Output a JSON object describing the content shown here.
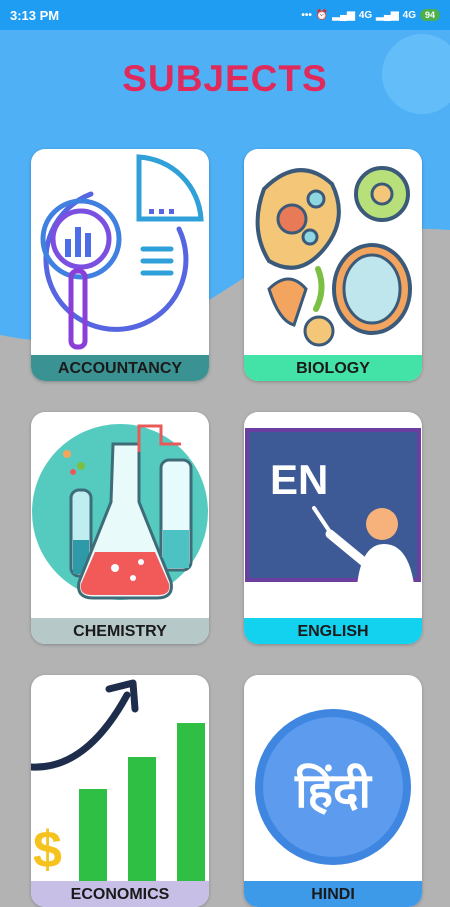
{
  "status_bar": {
    "time": "3:13 PM",
    "network": "4G",
    "network_2": "4G",
    "battery": "94"
  },
  "page": {
    "title": "SUBJECTS"
  },
  "subjects": [
    {
      "label": "ACCOUNTANCY"
    },
    {
      "label": "BIOLOGY"
    },
    {
      "label": "CHEMISTRY"
    },
    {
      "label": "ENGLISH",
      "board_text": "EN"
    },
    {
      "label": "ECONOMICS"
    },
    {
      "label": "HINDI",
      "glyph_text": "हिंदी"
    }
  ],
  "colors": {
    "status_bar": "#1e9df2",
    "header_blue": "#4fb0f6",
    "title": "#e12a5c",
    "background": "#b3b3b3"
  }
}
